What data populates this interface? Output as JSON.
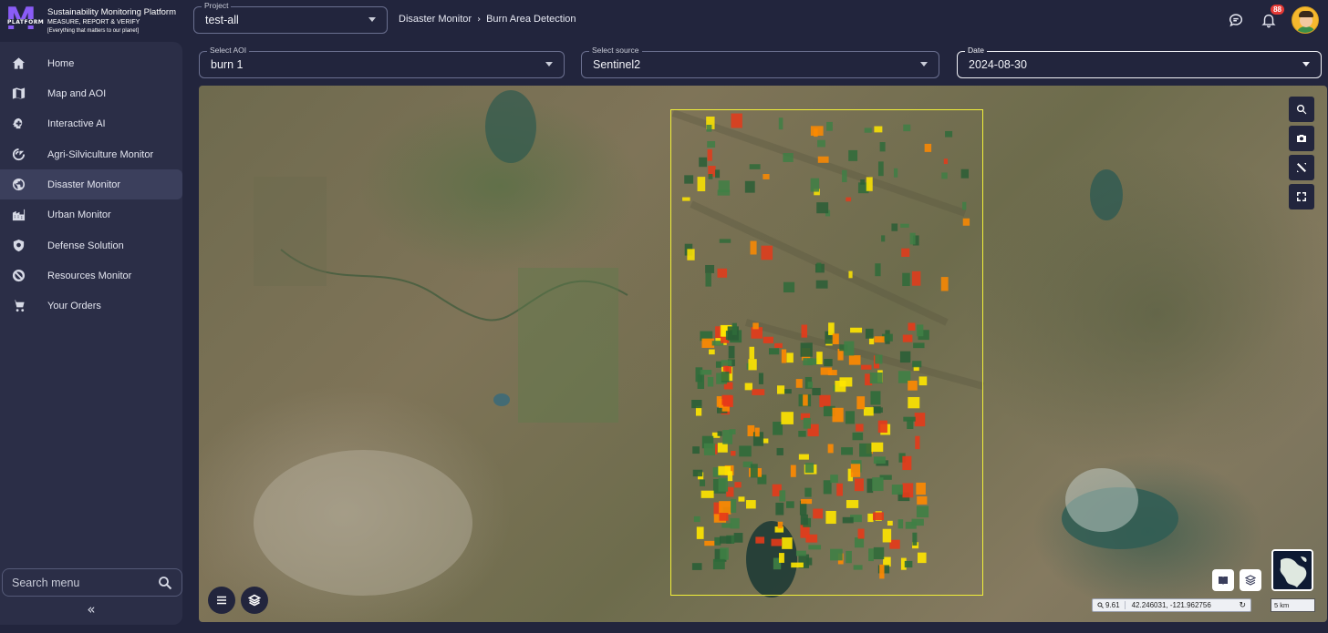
{
  "brand": {
    "logo_word": "PLATFORM",
    "title": "Sustainability Monitoring Platform",
    "subtitle": "MEASURE, REPORT & VERIFY",
    "tagline": "[Everything that matters to our planet]"
  },
  "sidebar": {
    "items": [
      {
        "label": "Home",
        "icon": "home-icon"
      },
      {
        "label": "Map and AOI",
        "icon": "map-icon"
      },
      {
        "label": "Interactive AI",
        "icon": "brain-icon"
      },
      {
        "label": "Agri-Silviculture Monitor",
        "icon": "sprout-icon"
      },
      {
        "label": "Disaster Monitor",
        "icon": "globe-icon",
        "active": true
      },
      {
        "label": "Urban Monitor",
        "icon": "city-icon"
      },
      {
        "label": "Defense Solution",
        "icon": "shield-icon"
      },
      {
        "label": "Resources Monitor",
        "icon": "no-entry-icon"
      },
      {
        "label": "Your Orders",
        "icon": "cart-icon"
      }
    ],
    "search_placeholder": "Search menu",
    "collapse_label": "«"
  },
  "header": {
    "project": {
      "label": "Project",
      "value": "test-all"
    },
    "breadcrumb": [
      "Disaster Monitor",
      "Burn Area Detection"
    ],
    "notifications_count": "88"
  },
  "filters": {
    "aoi": {
      "label": "Select AOI",
      "value": "burn 1"
    },
    "source": {
      "label": "Select source",
      "value": "Sentinel2"
    },
    "date": {
      "label": "Date",
      "value": "2024-08-30"
    }
  },
  "map": {
    "zoom": "9.61",
    "coordinates": "42.246031,  -121.962756",
    "scale": "5 km",
    "aoi_outline_color": "#f2f03a",
    "burn_colors": [
      "#ffe600",
      "#ff8a00",
      "#e53a1a"
    ],
    "tools": [
      "search-icon",
      "camera-icon",
      "measure-icon",
      "fullscreen-icon"
    ]
  },
  "colors": {
    "background": "#22253d",
    "sidebar": "#2b2e47",
    "active_item": "#3b3f5c",
    "badge": "#e53935"
  }
}
